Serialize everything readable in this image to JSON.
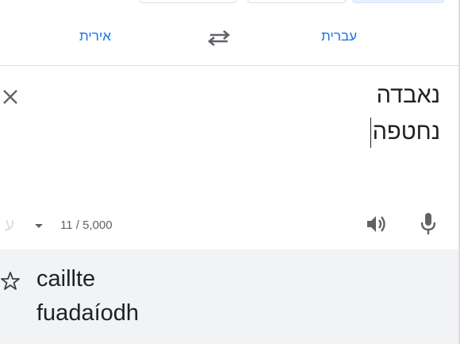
{
  "languages": {
    "source": "עברית",
    "target": "אירית"
  },
  "source": {
    "lines": [
      "נאבדה",
      "נחטפה"
    ],
    "char_count": "11 / 5,000",
    "keyboard_glyph": "ע"
  },
  "result": {
    "lines": [
      "caillte",
      "fuadaíodh"
    ]
  },
  "colors": {
    "accent": "#1a73e8",
    "text": "#202124",
    "muted": "#5f6368",
    "result_bg": "#f1f3f4",
    "divider": "#dadce0"
  },
  "icons": [
    "swap-languages-icon",
    "clear-text-icon",
    "keyboard-icon",
    "chevron-down-icon",
    "speaker-icon",
    "microphone-icon",
    "star-icon"
  ]
}
